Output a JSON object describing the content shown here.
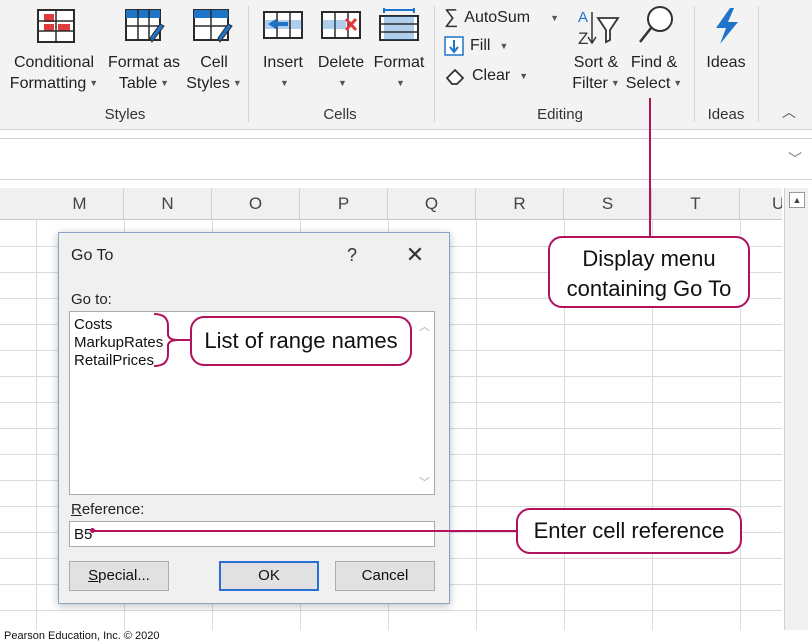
{
  "ribbon": {
    "styles_group": {
      "label": "Styles",
      "conditional_formatting": {
        "line1": "Conditional",
        "line2": "Formatting"
      },
      "format_as_table": {
        "line1": "Format as",
        "line2": "Table"
      },
      "cell_styles": {
        "line1": "Cell",
        "line2": "Styles"
      }
    },
    "cells_group": {
      "label": "Cells",
      "insert": "Insert",
      "delete": "Delete",
      "format": "Format"
    },
    "editing_group": {
      "label": "Editing",
      "autosum": "AutoSum",
      "fill": "Fill",
      "clear": "Clear",
      "sort_filter": {
        "line1": "Sort &",
        "line2": "Filter"
      },
      "find_select": {
        "line1": "Find &",
        "line2": "Select"
      }
    },
    "ideas_group": {
      "label": "Ideas",
      "ideas": "Ideas"
    },
    "colors": {
      "accent": "#1e74c8",
      "red": "#e0393e",
      "icon_outline": "#2b2b2b"
    }
  },
  "grid": {
    "columns": [
      "M",
      "N",
      "O",
      "P",
      "Q",
      "R",
      "S",
      "T",
      "U"
    ]
  },
  "dialog": {
    "title": "Go To",
    "help_glyph": "?",
    "close_glyph": "✕",
    "goto_label": "Go to:",
    "range_names": [
      "Costs",
      "MarkupRates",
      "RetailPrices"
    ],
    "reference_label_underlined": "R",
    "reference_label_rest": "eference:",
    "reference_value": "B5",
    "special_underlined": "S",
    "special_rest": "pecial...",
    "ok": "OK",
    "cancel": "Cancel"
  },
  "callouts": {
    "display_menu": {
      "line1": "Display menu",
      "line2": "containing Go To"
    },
    "range_names": "List of range names",
    "cell_reference": "Enter cell reference",
    "color": "#b0125b"
  },
  "copyright": "Pearson Education, Inc. © 2020"
}
